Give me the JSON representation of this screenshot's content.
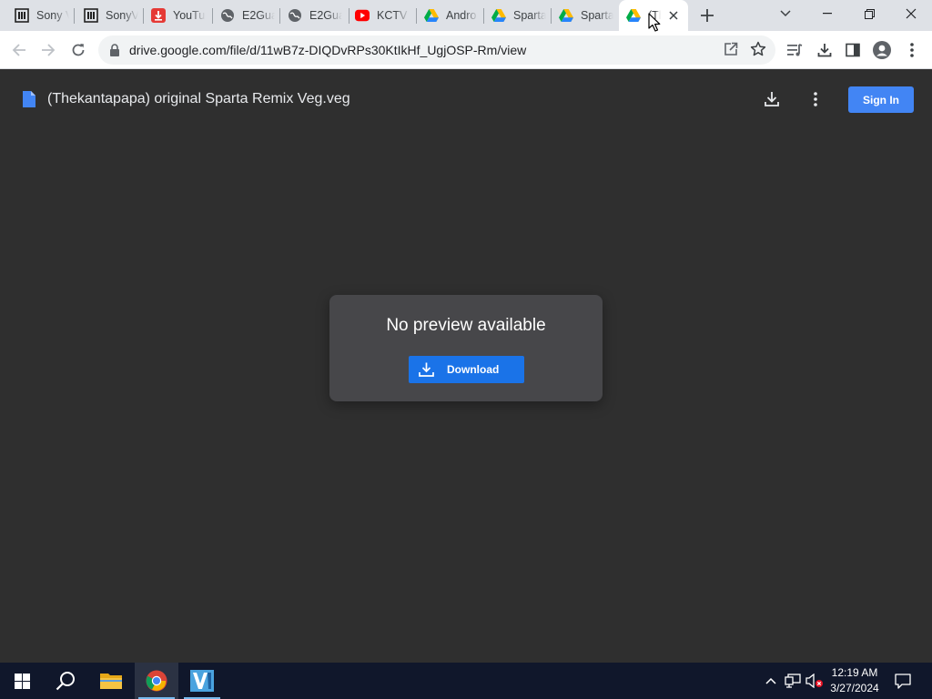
{
  "browser": {
    "tabs": [
      {
        "title": "Sony V",
        "icon": "archive-icon"
      },
      {
        "title": "SonyV",
        "icon": "archive-icon"
      },
      {
        "title": "YouTu",
        "icon": "download-app-icon"
      },
      {
        "title": "E2Gua",
        "icon": "globe-icon"
      },
      {
        "title": "E2Gua",
        "icon": "globe-icon"
      },
      {
        "title": "KCTV S",
        "icon": "youtube-icon"
      },
      {
        "title": "Andro",
        "icon": "google-drive-icon"
      },
      {
        "title": "Sparta",
        "icon": "google-drive-icon"
      },
      {
        "title": "Sparta",
        "icon": "google-drive-icon"
      },
      {
        "title": "(Th",
        "icon": "google-drive-icon",
        "active": true
      }
    ],
    "url": "drive.google.com/file/d/11wB7z-DIQDvRPs30KtIkHf_UgjOSP-Rm/view"
  },
  "viewer": {
    "file_title": "(Thekantapapa) original Sparta Remix Veg.veg",
    "sign_in_label": "Sign In",
    "no_preview_text": "No preview available",
    "download_label": "Download"
  },
  "taskbar": {
    "time": "12:19 AM",
    "date": "3/27/2024"
  },
  "colors": {
    "accent_blue": "#1a73e8",
    "sign_in_blue": "#4285f4",
    "viewer_bg": "#2f2f2f",
    "card_bg": "#47474a"
  }
}
